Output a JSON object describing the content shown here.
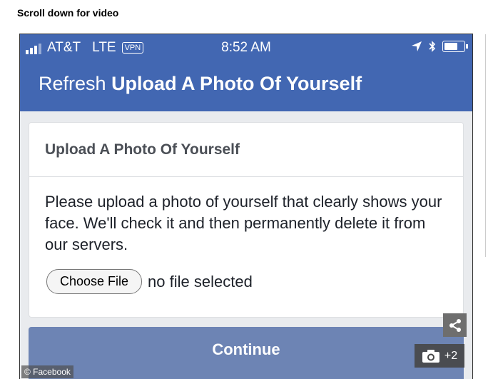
{
  "caption": "Scroll down for video",
  "status_bar": {
    "carrier": "AT&T",
    "network": "LTE",
    "vpn": "VPN",
    "time": "8:52 AM",
    "icons": [
      "location-arrow-icon",
      "bluetooth-icon",
      "battery-icon"
    ]
  },
  "nav": {
    "refresh": "Refresh",
    "title": "Upload A Photo Of Yourself"
  },
  "card": {
    "title": "Upload A Photo Of Yourself",
    "body": "Please upload a photo of yourself that clearly shows your face. We'll check it and then permanently delete it from our servers.",
    "choose_file_label": "Choose File",
    "no_file_text": "no file selected"
  },
  "continue_label": "Continue",
  "overlay": {
    "photo_count": "+2",
    "credit": "© Facebook",
    "icons": [
      "share-icon",
      "camera-icon"
    ]
  },
  "colors": {
    "header_blue": "#4267b2",
    "continue_blue": "#6d84b4",
    "page_bg": "#e9ebee"
  }
}
